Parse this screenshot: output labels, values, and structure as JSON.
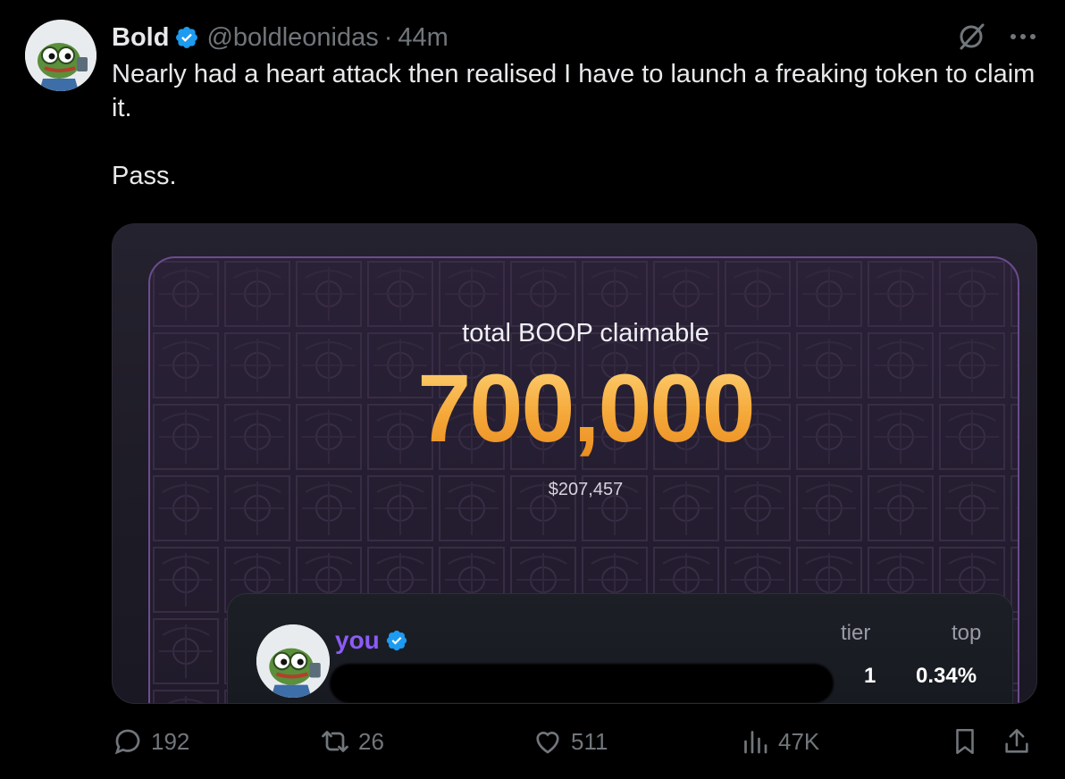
{
  "tweet": {
    "author_name": "Bold",
    "handle": "@boldleonidas",
    "separator": "·",
    "time": "44m",
    "text": "Nearly had a heart attack then realised I have to launch a freaking token to claim it.\n\nPass."
  },
  "media_card": {
    "label": "total BOOP claimable",
    "amount": "700,000",
    "usd_value": "$207,457",
    "user": {
      "name": "you",
      "tier_header": "tier",
      "top_header": "top",
      "tier_value": "1",
      "top_value": "0.34%"
    }
  },
  "actions": {
    "replies": "192",
    "reposts": "26",
    "likes": "511",
    "views": "47K"
  },
  "icons": {
    "verified": "verified-badge-icon",
    "grok": "grok-icon",
    "more": "more-icon",
    "reply": "reply-icon",
    "repost": "repost-icon",
    "like": "heart-icon",
    "views": "views-icon",
    "bookmark": "bookmark-icon",
    "share": "share-icon"
  },
  "colors": {
    "background": "#000000",
    "verified": "#1d9bf0",
    "muted": "#71767b",
    "amount_gradient_top": "#ffd57a",
    "amount_gradient_bottom": "#e98a1e",
    "you_label": "#8b5cf6",
    "card_border": "#6b4c8f"
  }
}
